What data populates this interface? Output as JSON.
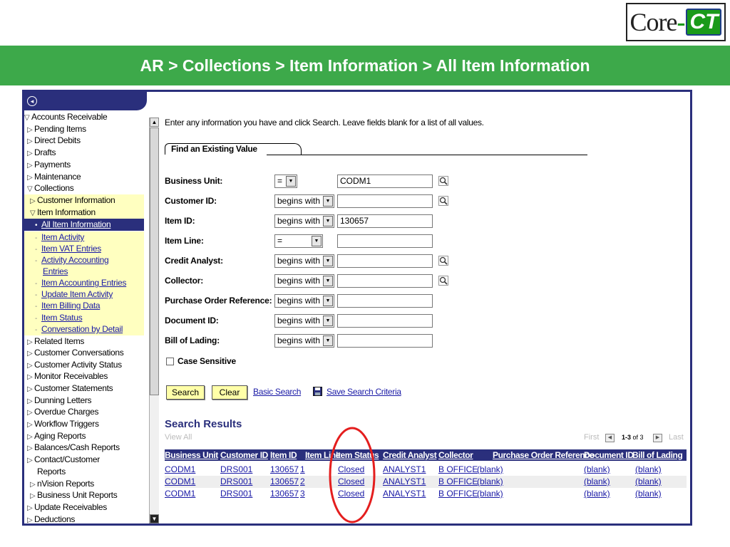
{
  "logo": {
    "text_core": "Core",
    "text_dash": "-",
    "text_ct": "CT"
  },
  "title": "AR > Collections > Item Information > All Item Information",
  "colors": {
    "title_bar": "#3da94a",
    "frame": "#2a2f7c",
    "link": "#1a1aa6",
    "button_bg": "#ffffa8",
    "grid_header": "#2a2f7c",
    "selected_nav": "#2a2f7c",
    "annotation": "#e41e1e"
  },
  "nav": {
    "items": [
      {
        "label": "Accounts Receivable",
        "icon": "triangle-down-icon",
        "link": false
      },
      {
        "label": "Pending Items",
        "icon": "triangle-right-icon",
        "link": false
      },
      {
        "label": "Direct Debits",
        "icon": "triangle-right-icon",
        "link": false
      },
      {
        "label": "Drafts",
        "icon": "triangle-right-icon",
        "link": false
      },
      {
        "label": "Payments",
        "icon": "triangle-right-icon",
        "link": false
      },
      {
        "label": "Maintenance",
        "icon": "triangle-right-icon",
        "link": false
      },
      {
        "label": "Collections",
        "icon": "triangle-down-icon",
        "link": false
      },
      {
        "label": "Customer Information",
        "icon": "triangle-right-icon",
        "link": false
      },
      {
        "label": "Item Information",
        "icon": "triangle-down-icon",
        "link": false
      },
      {
        "label": "All Item Information",
        "icon": "bullet-icon",
        "link": true
      },
      {
        "label": "Item Activity",
        "icon": "dash-icon",
        "link": true
      },
      {
        "label": "Item VAT Entries",
        "icon": "dash-icon",
        "link": true
      },
      {
        "label": "Activity Accounting",
        "icon": "dash-icon",
        "link": true
      },
      {
        "label": "Entries",
        "icon": "",
        "link": true
      },
      {
        "label": "Item Accounting Entries",
        "icon": "dash-icon",
        "link": true
      },
      {
        "label": "Update Item Activity",
        "icon": "dash-icon",
        "link": true
      },
      {
        "label": "Item Billing Data",
        "icon": "dash-icon",
        "link": true
      },
      {
        "label": "Item Status",
        "icon": "dash-icon",
        "link": true
      },
      {
        "label": "Conversation by Detail",
        "icon": "dash-icon",
        "link": true
      },
      {
        "label": "Related Items",
        "icon": "triangle-right-icon",
        "link": false
      },
      {
        "label": "Customer Conversations",
        "icon": "triangle-right-icon",
        "link": false
      },
      {
        "label": "Customer Activity Status",
        "icon": "triangle-right-icon",
        "link": false
      },
      {
        "label": "Monitor Receivables",
        "icon": "triangle-right-icon",
        "link": false
      },
      {
        "label": "Customer Statements",
        "icon": "triangle-right-icon",
        "link": false
      },
      {
        "label": "Dunning Letters",
        "icon": "triangle-right-icon",
        "link": false
      },
      {
        "label": "Overdue Charges",
        "icon": "triangle-right-icon",
        "link": false
      },
      {
        "label": "Workflow Triggers",
        "icon": "triangle-right-icon",
        "link": false
      },
      {
        "label": "Aging Reports",
        "icon": "triangle-right-icon",
        "link": false
      },
      {
        "label": "Balances/Cash Reports",
        "icon": "triangle-right-icon",
        "link": false
      },
      {
        "label": "Contact/Customer",
        "icon": "triangle-right-icon",
        "link": false
      },
      {
        "label": "Reports",
        "icon": "",
        "link": false
      },
      {
        "label": "nVision Reports",
        "icon": "triangle-right-icon",
        "link": false
      },
      {
        "label": "Business Unit Reports",
        "icon": "triangle-right-icon",
        "link": false
      },
      {
        "label": "Update Receivables",
        "icon": "triangle-right-icon",
        "link": false
      },
      {
        "label": "Deductions",
        "icon": "triangle-right-icon",
        "link": false
      }
    ]
  },
  "search": {
    "instructions": "Enter any information you have and click Search. Leave fields blank for a list of all values.",
    "tab_label": "Find an Existing Value",
    "fields": [
      {
        "label": "Business Unit:",
        "operator": "=",
        "value": "CODM1",
        "lookup": true
      },
      {
        "label": "Customer ID:",
        "operator": "begins with",
        "value": "",
        "lookup": true
      },
      {
        "label": "Item ID:",
        "operator": "begins with",
        "value": "130657",
        "lookup": false
      },
      {
        "label": "Item Line:",
        "operator": "=",
        "value": "",
        "lookup": false
      },
      {
        "label": "Credit Analyst:",
        "operator": "begins with",
        "value": "",
        "lookup": true
      },
      {
        "label": "Collector:",
        "operator": "begins with",
        "value": "",
        "lookup": true
      },
      {
        "label": "Purchase Order Reference:",
        "operator": "begins with",
        "value": "",
        "lookup": false
      },
      {
        "label": "Document ID:",
        "operator": "begins with",
        "value": "",
        "lookup": false
      },
      {
        "label": "Bill of Lading:",
        "operator": "begins with",
        "value": "",
        "lookup": false
      }
    ],
    "case_sensitive_label": "Case Sensitive",
    "search_button": "Search",
    "clear_button": "Clear",
    "basic_search_link": "Basic Search",
    "save_criteria_link": "Save Search Criteria"
  },
  "results": {
    "title": "Search Results",
    "view_all": "View All",
    "first": "First",
    "range": "1-3",
    "of_text": "of 3",
    "last": "Last",
    "headers": [
      "Business Unit",
      "Customer ID",
      "Item ID",
      "Item Line",
      "Item Status",
      "Credit Analyst",
      "Collector",
      "Purchase Order Reference",
      "Document ID",
      "Bill of Lading"
    ],
    "rows": [
      [
        "CODM1",
        "DRS001",
        "130657",
        "1",
        "Closed",
        "ANALYST1",
        "B OFFICE",
        "(blank)",
        "(blank)",
        "(blank)"
      ],
      [
        "CODM1",
        "DRS001",
        "130657",
        "2",
        "Closed",
        "ANALYST1",
        "B OFFICE",
        "(blank)",
        "(blank)",
        "(blank)"
      ],
      [
        "CODM1",
        "DRS001",
        "130657",
        "3",
        "Closed",
        "ANALYST1",
        "B OFFICE",
        "(blank)",
        "(blank)",
        "(blank)"
      ]
    ]
  }
}
